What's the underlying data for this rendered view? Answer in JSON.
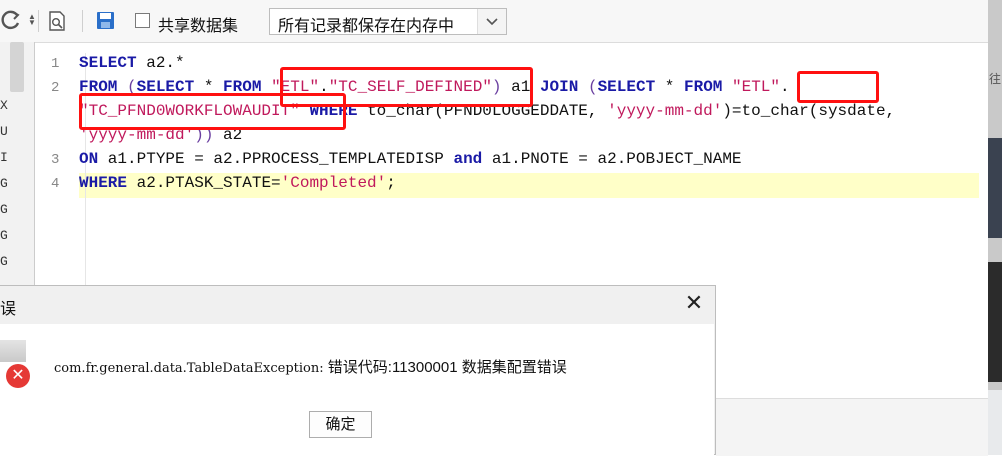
{
  "toolbar": {
    "refresh_icon": "refresh-icon",
    "share_dataset_label": "共享数据集",
    "share_dataset_checked": false,
    "memory_mode_value": "所有记录都保存在内存中"
  },
  "left_panel": {
    "letters": [
      "X",
      "U",
      "I",
      "G",
      "G",
      "G",
      "G"
    ]
  },
  "editor": {
    "line_numbers": [
      "1",
      "2",
      "3",
      "4"
    ],
    "lines": [
      [
        {
          "t": "kw",
          "v": "SELECT"
        },
        {
          "t": "n",
          "v": " a2.*"
        }
      ],
      [
        {
          "t": "kw",
          "v": "FROM"
        },
        {
          "t": "n",
          "v": " "
        },
        {
          "t": "paren",
          "v": "("
        },
        {
          "t": "kw",
          "v": "SELECT"
        },
        {
          "t": "n",
          "v": " * "
        },
        {
          "t": "kw",
          "v": "FROM"
        },
        {
          "t": "n",
          "v": " "
        },
        {
          "t": "str",
          "v": "\"ETL\""
        },
        {
          "t": "n",
          "v": "."
        },
        {
          "t": "str",
          "v": "\"TC_SELF_DEFINED\""
        },
        {
          "t": "paren",
          "v": ")"
        },
        {
          "t": "n",
          "v": " a1 "
        },
        {
          "t": "kw",
          "v": "JOIN"
        },
        {
          "t": "n",
          "v": " "
        },
        {
          "t": "paren",
          "v": "("
        },
        {
          "t": "kw",
          "v": "SELECT"
        },
        {
          "t": "n",
          "v": " * "
        },
        {
          "t": "kw",
          "v": "FROM"
        },
        {
          "t": "n",
          "v": " "
        },
        {
          "t": "str",
          "v": "\"ETL\""
        },
        {
          "t": "n",
          "v": "."
        }
      ],
      [
        {
          "t": "str",
          "v": "\"TC_PFND0WORKFLOWAUDIT\""
        },
        {
          "t": "n",
          "v": " "
        },
        {
          "t": "kw",
          "v": "WHERE"
        },
        {
          "t": "n",
          "v": " to_char(PFND0LOGGEDDATE, "
        },
        {
          "t": "str",
          "v": "'yyyy-mm-dd'"
        },
        {
          "t": "n",
          "v": ")=to_char(sysdate,"
        }
      ],
      [
        {
          "t": "str",
          "v": "'yyyy-mm-dd'"
        },
        {
          "t": "paren",
          "v": "))"
        },
        {
          "t": "n",
          "v": " a2"
        }
      ],
      [
        {
          "t": "kw",
          "v": "ON"
        },
        {
          "t": "n",
          "v": " a1.PTYPE = a2.PPROCESS_TEMPLATEDISP "
        },
        {
          "t": "kw",
          "v": "and"
        },
        {
          "t": "n",
          "v": " a1.PNOTE = a2.POBJECT_NAME"
        }
      ],
      [
        {
          "t": "kw",
          "v": "WHERE"
        },
        {
          "t": "n",
          "v": " a2.PTASK_STATE="
        },
        {
          "t": "str",
          "v": "'Completed'"
        },
        {
          "t": "n",
          "v": ";"
        }
      ]
    ]
  },
  "dialog": {
    "title": "误",
    "close_glyph": "✕",
    "error_icon": "error-icon",
    "error_glyph": "✕",
    "message_class": "com.fr.general.data.TableDataException:",
    "message_text": " 错误代码:11300001 数据集配置错误",
    "ok_label": "确定"
  },
  "colors": {
    "keyword": "#1a1aa6",
    "string": "#c0195c",
    "highlight_row": "#ffffc8",
    "annotation_box": "#ff1010",
    "error_red": "#e53935"
  }
}
